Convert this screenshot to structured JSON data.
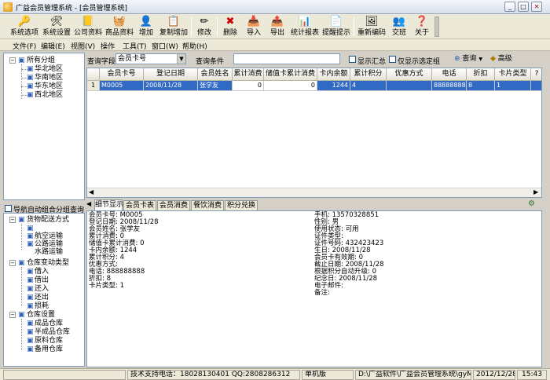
{
  "window": {
    "title": "广益会员管理系统 - [会员管理系统]",
    "controls": [
      "_",
      "□",
      "✕"
    ]
  },
  "toolbar": {
    "items": [
      {
        "label": "系统选项",
        "icon": "key-icon",
        "glyph": "🔑"
      },
      {
        "label": "系统设置",
        "icon": "tools-icon",
        "glyph": "🛠"
      },
      {
        "label": "公司资料",
        "icon": "company-icon",
        "glyph": "📒"
      },
      {
        "label": "商品资料",
        "icon": "goods-icon",
        "glyph": "🧺"
      },
      {
        "label": "增加",
        "icon": "add-user-icon",
        "glyph": "👤"
      },
      {
        "label": "复制增加",
        "icon": "copy-add-icon",
        "glyph": "📋"
      },
      {
        "label": "修改",
        "icon": "pencil-icon",
        "glyph": "✏"
      },
      {
        "label": "删除",
        "icon": "delete-icon",
        "glyph": "✖"
      },
      {
        "label": "导入",
        "icon": "import-icon",
        "glyph": "📥"
      },
      {
        "label": "导出",
        "icon": "export-icon",
        "glyph": "📤"
      },
      {
        "label": "统计报表",
        "icon": "report-icon",
        "glyph": "📊"
      },
      {
        "label": "提醒提示",
        "icon": "reminder-icon",
        "glyph": "📄"
      },
      {
        "label": "重新编码",
        "icon": "recode-icon",
        "glyph": "🖼"
      },
      {
        "label": "交班",
        "icon": "handover-icon",
        "glyph": "👥"
      },
      {
        "label": "关于",
        "icon": "help-icon",
        "glyph": "❓"
      }
    ]
  },
  "menubar": {
    "items": [
      "文件(F)",
      "编辑(E)",
      "视图(V)",
      "操作",
      "工具(T)",
      "窗口(W)",
      "帮助(H)"
    ]
  },
  "tree_top": {
    "root": "所有分组",
    "children": [
      "华北地区",
      "华南地区",
      "华东地区",
      "西北地区"
    ]
  },
  "nav_panel": {
    "checkbox_label": "导航自动组合分组查询"
  },
  "tree_bottom": {
    "groups": [
      {
        "label": "货物配送方式",
        "children": [
          "航空运输",
          "公路运输",
          "水路运输"
        ]
      },
      {
        "label": "仓库变动类型",
        "children": [
          "借入",
          "借出",
          "还入",
          "还出",
          "损耗"
        ]
      },
      {
        "label": "仓库设置",
        "children": [
          "成品仓库",
          "半成品仓库",
          "原料仓库",
          "备用仓库"
        ]
      }
    ]
  },
  "query": {
    "field_label": "查询字段",
    "field_value": "会员卡号",
    "condition_label": "查询条件",
    "condition_value": "",
    "show_summary": "显示汇总",
    "show_selected_only": "仅显示选定组",
    "query_button": "查询",
    "advanced_button": "高级"
  },
  "grid": {
    "columns": [
      "会员卡号",
      "登记日期",
      "会员姓名",
      "累计消费",
      "储值卡累计消费",
      "卡内余额",
      "累计积分",
      "优惠方式",
      "电话",
      "折扣",
      "卡片类型",
      "?"
    ],
    "rows": [
      {
        "marker": "1",
        "cells": [
          "M0005",
          "2008/11/28",
          "张学友",
          "0",
          "0",
          "1244",
          "4",
          "",
          "888888888",
          "8",
          "1",
          ""
        ]
      }
    ]
  },
  "tabs": [
    "细节显示",
    "会员卡表",
    "会员消费",
    "餐饮消费",
    "积分兑换"
  ],
  "detail_left": [
    "会员卡号: M0005",
    "登记日期: 2008/11/28",
    "会员姓名: 张学友",
    "累计消费: 0",
    "储值卡累计消费: 0",
    "卡内余额: 1244",
    "累计积分: 4",
    "优惠方式:",
    "电话: 888888888",
    "折扣: 8",
    "卡片类型: 1"
  ],
  "detail_right": [
    "手机: 13570328851",
    "性别: 男",
    "使用状态: 可用",
    "证件类型:",
    "证件号码: 432423423",
    "生日: 2008/11/28",
    "会员卡有效期: 0",
    "截止日期: 2008/11/28",
    "根据积分自动升级: 0",
    "纪念日: 2008/11/28",
    "电子邮件:",
    "备注:"
  ],
  "statusbar": {
    "support": "技术支持电话：18028130401 QQ:2808286312",
    "mode": "单机版",
    "path": "D:\\广益软件\\广益会员管理系统\\gyMe",
    "date": "2012/12/28",
    "time": "15:43"
  },
  "colors": {
    "selection": "#316ac5",
    "panel_border": "#7f9db9",
    "toolbar_bg": "#ece9d8"
  }
}
